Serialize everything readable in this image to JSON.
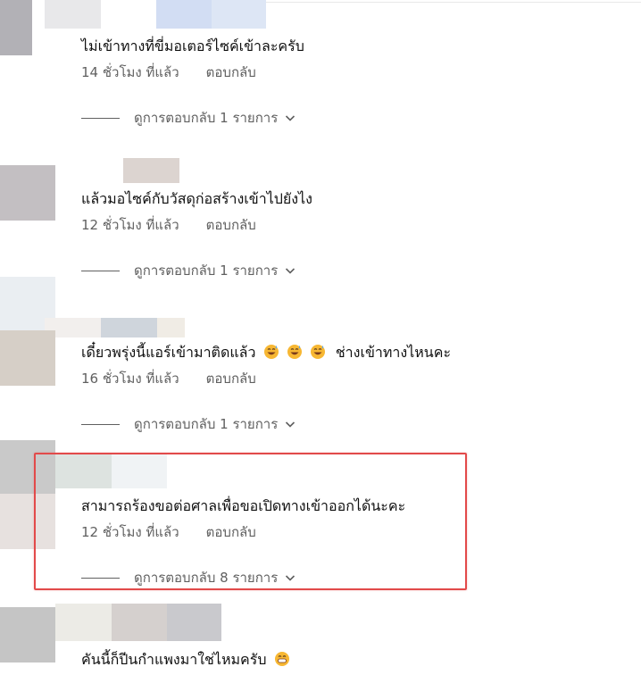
{
  "comments": [
    {
      "text": "ไม่เข้าทางที่ขี่มอเตอร์ไซค์เข้าละครับ",
      "time": "14 ชั่วโมง ที่แล้ว",
      "reply_label": "ตอบกลับ",
      "replies_label": "ดูการตอบกลับ 1 รายการ"
    },
    {
      "text": "แล้วมอไซค์กับวัสดุก่อสร้างเข้าไปยังไง",
      "time": "12 ชั่วโมง ที่แล้ว",
      "reply_label": "ตอบกลับ",
      "replies_label": "ดูการตอบกลับ 1 รายการ"
    },
    {
      "text": "เดี๋ยวพรุ่งนี้แอร์เข้ามาติดแล้ว",
      "text_after": "ช่างเข้าทางไหนคะ",
      "time": "16 ชั่วโมง ที่แล้ว",
      "reply_label": "ตอบกลับ",
      "replies_label": "ดูการตอบกลับ 1 รายการ"
    },
    {
      "text": "สามารถร้องขอต่อศาลเพื่อขอเปิดทางเข้าออกได้นะคะ",
      "time": "12 ชั่วโมง ที่แล้ว",
      "reply_label": "ตอบกลับ",
      "replies_label": "ดูการตอบกลับ 8 รายการ"
    },
    {
      "text": "คันนี้ก็ปีนกำแพงมาใช่ไหมครับ"
    }
  ],
  "colors": {
    "highlight": "#e24a4a",
    "text": "#0f0f0f",
    "secondary": "#606060"
  },
  "icons": {
    "expand": "chevron-down-icon",
    "emoji_sweat": "grinning-sweat-emoji-icon",
    "emoji_grin": "grinning-teeth-emoji-icon"
  }
}
